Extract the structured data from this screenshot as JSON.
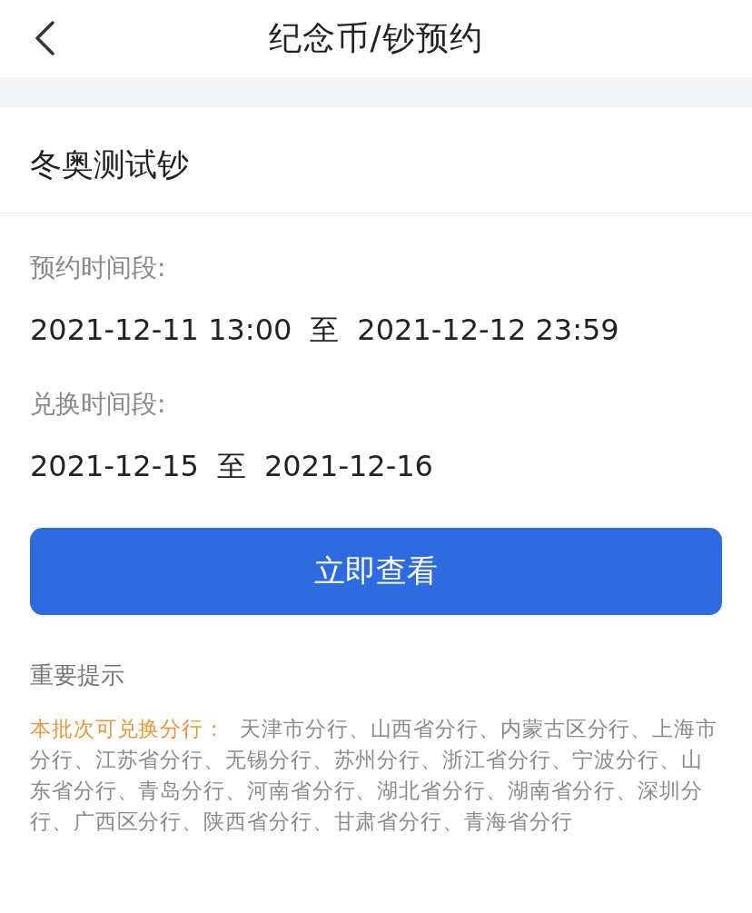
{
  "header": {
    "title": "纪念币/钞预约"
  },
  "item": {
    "name": "冬奥测试钞",
    "periods": [
      {
        "label": "预约时间段:",
        "start": "2021-12-11 13:00",
        "separator": "至",
        "end": "2021-12-12 23:59"
      },
      {
        "label": "兑换时间段:",
        "start": "2021-12-15",
        "separator": "至",
        "end": "2021-12-16"
      }
    ],
    "button": "立即查看"
  },
  "notice": {
    "title": "重要提示",
    "branches_label": "本批次可兑换分行：",
    "branches": "天津市分行、山西省分行、内蒙古区分行、上海市分行、江苏省分行、无锡分行、苏州分行、浙江省分行、宁波分行、山东省分行、青岛分行、河南省分行、湖北省分行、湖南省分行、深圳分行、广西区分行、陕西省分行、甘肃省分行、青海省分行"
  }
}
